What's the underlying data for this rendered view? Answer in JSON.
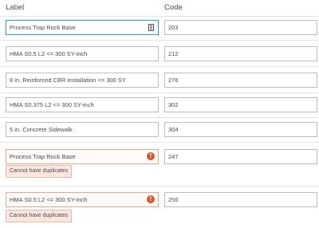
{
  "header": {
    "label_column": "Label",
    "code_column": "Code"
  },
  "rows": [
    {
      "label": "Process Trap Rock Base",
      "code": "203",
      "state": "focused"
    },
    {
      "label": "HMA S0.5 L2 <= 300 SY-inch",
      "code": "212",
      "state": "normal"
    },
    {
      "label": "8 in. Reinforced CBR Installation <= 300 SY",
      "code": "276",
      "state": "normal"
    },
    {
      "label": "HMA S0.375 L2 <= 300 SY-inch",
      "code": "302",
      "state": "normal"
    },
    {
      "label": "5 in. Concrete Sidewalk",
      "code": "304",
      "state": "normal"
    },
    {
      "label": "Process Trap Rock Base",
      "code": "247",
      "state": "error",
      "error_message": "Cannot have duplicates"
    },
    {
      "label": "HMA S0.5 L2 <= 300 SY-inch",
      "code": "256",
      "state": "error",
      "error_message": "Cannot have duplicates"
    }
  ],
  "icons": {
    "focused_field_icon": "clipboard-icon",
    "error_icon": "alert-circle-icon"
  },
  "colors": {
    "focus_border": "#2b9fd6",
    "error_border": "#e5a68f",
    "error_icon": "#d9572e",
    "tooltip_bg": "#fbe5df"
  }
}
